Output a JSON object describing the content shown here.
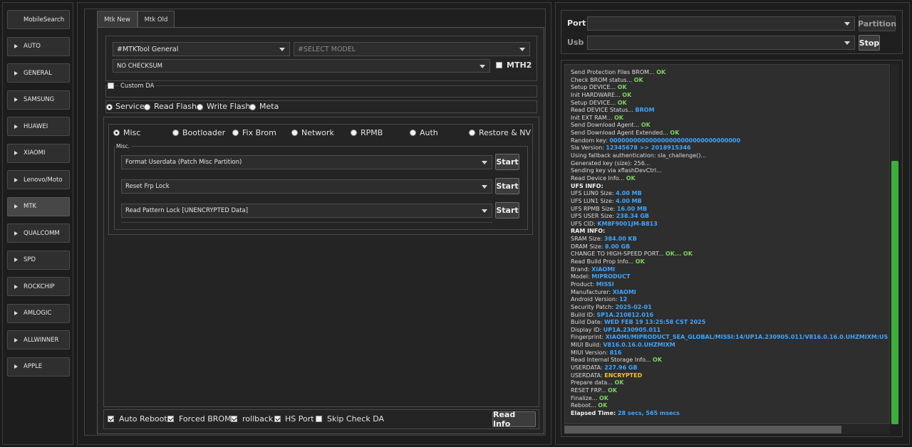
{
  "sidebar": {
    "items": [
      {
        "label": "MobileSearch",
        "icon": "none"
      },
      {
        "label": "AUTO",
        "icon": "arrow-right-icon"
      },
      {
        "label": "GENERAL",
        "icon": "arrow-right-icon"
      },
      {
        "label": "SAMSUNG",
        "icon": "arrow-right-icon"
      },
      {
        "label": "HUAWEI",
        "icon": "arrow-right-icon"
      },
      {
        "label": "XIAOMI",
        "icon": "arrow-right-icon"
      },
      {
        "label": "Lenovo/Moto",
        "icon": "arrow-right-icon"
      },
      {
        "label": "MTK",
        "icon": "arrow-right-icon"
      },
      {
        "label": "QUALCOMM",
        "icon": "arrow-right-icon"
      },
      {
        "label": "SPD",
        "icon": "arrow-right-icon"
      },
      {
        "label": "ROCKCHIP",
        "icon": "arrow-right-icon"
      },
      {
        "label": "AMLOGIC",
        "icon": "arrow-right-icon"
      },
      {
        "label": "ALLWINNER",
        "icon": "arrow-right-icon"
      },
      {
        "label": "APPLE",
        "icon": "arrow-right-icon"
      }
    ],
    "active": "MTK"
  },
  "tabs": [
    {
      "label": "Mtk New"
    },
    {
      "label": "Mtk Old"
    }
  ],
  "active_tab": "Mtk New",
  "top": {
    "tool_select": "#MTKTool General",
    "model_select_placeholder": "#SELECT MODEL",
    "checksum_select": "NO CHECKSUM",
    "mth2_label": "MTH2",
    "custom_da_label": "Custom DA"
  },
  "modes": [
    {
      "label": "Service",
      "checked": true
    },
    {
      "label": "Read Flash",
      "checked": false
    },
    {
      "label": "Write Flash",
      "checked": false
    },
    {
      "label": "Meta",
      "checked": false
    }
  ],
  "subtabs": [
    {
      "label": "Misc",
      "checked": true
    },
    {
      "label": "Bootloader",
      "checked": false
    },
    {
      "label": "Fix Brom",
      "checked": false
    },
    {
      "label": "Network",
      "checked": false
    },
    {
      "label": "RPMB",
      "checked": false
    },
    {
      "label": "Auth",
      "checked": false
    },
    {
      "label": "Restore & NV",
      "checked": false
    }
  ],
  "misc": {
    "group_title": "Misc.",
    "rows": [
      {
        "option": "Format Userdata (Patch Misc Partition)",
        "button": "Start"
      },
      {
        "option": "Reset Frp Lock",
        "button": "Start"
      },
      {
        "option": "Read Pattern Lock [UNENCRYPTED Data]",
        "button": "Start"
      }
    ]
  },
  "bottom": {
    "options": [
      {
        "label": "Auto Reboot",
        "checked": true
      },
      {
        "label": "Forced BROM",
        "checked": true
      },
      {
        "label": "rollback",
        "checked": true
      },
      {
        "label": "HS Port",
        "checked": true
      },
      {
        "label": "Skip Check DA",
        "checked": false
      }
    ],
    "read_info_button": "Read Info"
  },
  "right": {
    "port_label": "Port",
    "usb_label": "Usb",
    "partition_button": "Partition",
    "stop_button": "Stop"
  },
  "colors": {
    "ok": "#7cd35e",
    "value": "#3ea6ff",
    "warn": "#f0c419",
    "progress": "#3cae3c"
  },
  "log": [
    [
      {
        "t": "Send Protection Files BROM... ",
        "c": "t"
      },
      {
        "t": "OK",
        "c": "ok"
      }
    ],
    [
      {
        "t": "Check BROM status... ",
        "c": "t"
      },
      {
        "t": "OK",
        "c": "ok"
      }
    ],
    [
      {
        "t": "Setup DEVICE... ",
        "c": "t"
      },
      {
        "t": "OK",
        "c": "ok"
      }
    ],
    [
      {
        "t": "Init HARDWARE... ",
        "c": "t"
      },
      {
        "t": "OK",
        "c": "ok"
      }
    ],
    [
      {
        "t": "Setup DEVICE... ",
        "c": "t"
      },
      {
        "t": "OK",
        "c": "ok"
      }
    ],
    [
      {
        "t": "Read DEVICE Status... ",
        "c": "t"
      },
      {
        "t": "BROM",
        "c": "bl"
      }
    ],
    [
      {
        "t": "Init EXT RAM... ",
        "c": "t"
      },
      {
        "t": "OK",
        "c": "ok"
      }
    ],
    [
      {
        "t": "Send Download Agent... ",
        "c": "t"
      },
      {
        "t": "OK",
        "c": "ok"
      }
    ],
    [
      {
        "t": "Send Download Agent Extended... ",
        "c": "t"
      },
      {
        "t": "OK",
        "c": "ok"
      }
    ],
    [
      {
        "t": "Random key:  ",
        "c": "t"
      },
      {
        "t": "000000000000000000000000000000000",
        "c": "bl"
      }
    ],
    [
      {
        "t": "Sla Version:  ",
        "c": "t"
      },
      {
        "t": "12345678  >> 2018915346",
        "c": "bl"
      }
    ],
    [
      {
        "t": "Using fallback authentication: sla_challenge()...",
        "c": "t"
      }
    ],
    [
      {
        "t": "Generated key (size): 256...",
        "c": "t"
      }
    ],
    [
      {
        "t": "Sending key via xflashDevCtrl...",
        "c": "t"
      }
    ],
    [
      {
        "t": "Read Device Info... ",
        "c": "t"
      },
      {
        "t": "OK",
        "c": "ok"
      }
    ],
    [
      {
        "t": "UFS INFO:",
        "c": "wb"
      }
    ],
    [
      {
        "t": "UFS LUN0 Size: ",
        "c": "t"
      },
      {
        "t": "4.00 MB",
        "c": "bl"
      }
    ],
    [
      {
        "t": "UFS LUN1 Size: ",
        "c": "t"
      },
      {
        "t": "4.00 MB",
        "c": "bl"
      }
    ],
    [
      {
        "t": "UFS RPMB Size: ",
        "c": "t"
      },
      {
        "t": "16.00 MB",
        "c": "bl"
      }
    ],
    [
      {
        "t": "UFS USER Size: ",
        "c": "t"
      },
      {
        "t": "238.34 GB",
        "c": "bl"
      }
    ],
    [
      {
        "t": "UFS CID: ",
        "c": "t"
      },
      {
        "t": "KM8F9001JM-B813",
        "c": "bl"
      }
    ],
    [
      {
        "t": "RAM INFO:",
        "c": "wb"
      }
    ],
    [
      {
        "t": "SRAM Size: ",
        "c": "t"
      },
      {
        "t": "384.00 KB",
        "c": "bl"
      }
    ],
    [
      {
        "t": "DRAM Size: ",
        "c": "t"
      },
      {
        "t": "8.00 GB",
        "c": "bl"
      }
    ],
    [
      {
        "t": "CHANGE TO HIGH-SPEED PORT... ",
        "c": "t"
      },
      {
        "t": "OK... OK",
        "c": "ok"
      }
    ],
    [
      {
        "t": "Read Build Prop Info... ",
        "c": "t"
      },
      {
        "t": "OK",
        "c": "ok"
      }
    ],
    [
      {
        "t": " Brand: ",
        "c": "t"
      },
      {
        "t": "XIAOMI",
        "c": "bl"
      }
    ],
    [
      {
        "t": " Model: ",
        "c": "t"
      },
      {
        "t": "MIPRODUCT",
        "c": "bl"
      }
    ],
    [
      {
        "t": " Product: ",
        "c": "t"
      },
      {
        "t": "MISSI",
        "c": "bl"
      }
    ],
    [
      {
        "t": " Manufacturer: ",
        "c": "t"
      },
      {
        "t": "XIAOMI",
        "c": "bl"
      }
    ],
    [
      {
        "t": " Android Version: ",
        "c": "t"
      },
      {
        "t": "12",
        "c": "bl"
      }
    ],
    [
      {
        "t": " Security Patch: ",
        "c": "t"
      },
      {
        "t": "2025-02-01",
        "c": "bl"
      }
    ],
    [
      {
        "t": " Build ID: ",
        "c": "t"
      },
      {
        "t": "SP1A.210812.016",
        "c": "bl"
      }
    ],
    [
      {
        "t": " Build Date: ",
        "c": "t"
      },
      {
        "t": "WED FEB 19 13:25:58 CST 2025",
        "c": "bl"
      }
    ],
    [
      {
        "t": " Display ID: ",
        "c": "t"
      },
      {
        "t": "UP1A.230905.011",
        "c": "bl"
      }
    ],
    [
      {
        "t": " Fingerprint: ",
        "c": "t"
      },
      {
        "t": "XIAOMI/MIPRODUCT_SEA_GLOBAL/MISSI:14/UP1A.230905.011/V816.0.16.0.UHZMIXM:USE",
        "c": "bl"
      }
    ],
    [
      {
        "t": " MIUI Build: ",
        "c": "t"
      },
      {
        "t": "V816.0.16.0.UHZMIXM",
        "c": "bl"
      }
    ],
    [
      {
        "t": " MIUI Version: ",
        "c": "t"
      },
      {
        "t": "816",
        "c": "bl"
      }
    ],
    [
      {
        "t": "Read Internal Storage Info... ",
        "c": "t"
      },
      {
        "t": "OK",
        "c": "ok"
      }
    ],
    [
      {
        "t": "USERDATA: ",
        "c": "t"
      },
      {
        "t": "227.96 GB",
        "c": "bl"
      }
    ],
    [
      {
        "t": "USERDATA: ",
        "c": "t"
      },
      {
        "t": "ENCRYPTED",
        "c": "yl"
      }
    ],
    [
      {
        "t": "Prepare data... ",
        "c": "t"
      },
      {
        "t": "OK",
        "c": "ok"
      }
    ],
    [
      {
        "t": "RESET FRP... ",
        "c": "t"
      },
      {
        "t": "OK",
        "c": "ok"
      }
    ],
    [
      {
        "t": "Finalize... ",
        "c": "t"
      },
      {
        "t": "OK",
        "c": "ok"
      }
    ],
    [
      {
        "t": "Reboot... ",
        "c": "t"
      },
      {
        "t": "OK",
        "c": "ok"
      }
    ],
    [
      {
        "t": "Elapsed Time: ",
        "c": "wb"
      },
      {
        "t": "28 secs, 565 msecs",
        "c": "bl"
      }
    ]
  ]
}
